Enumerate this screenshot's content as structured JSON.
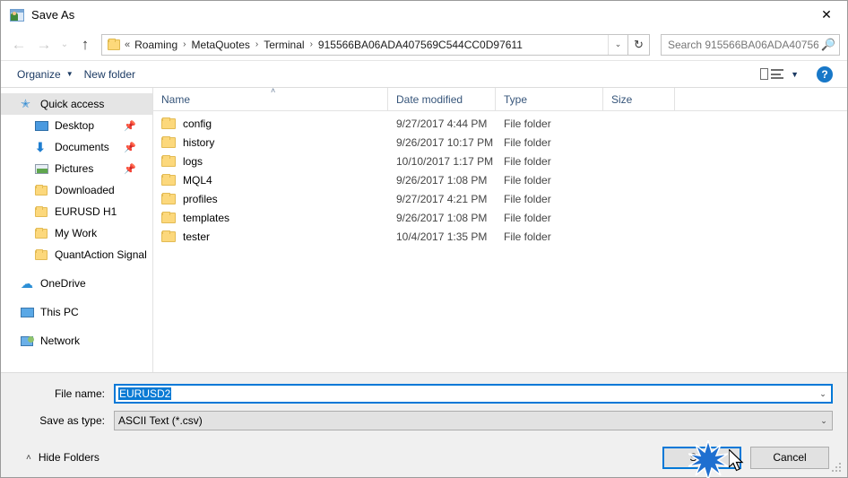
{
  "window": {
    "title": "Save As",
    "title_icon": "save-as-window-icon",
    "close_icon": "✕"
  },
  "nav": {
    "back_icon": "←",
    "forward_icon": "→",
    "recent_icon": "⌄",
    "up_icon": "↑",
    "refresh_icon": "↻",
    "dropdown_icon": "⌄",
    "folder_icon": "folder-icon",
    "overflow": "«",
    "breadcrumbs": [
      "Roaming",
      "MetaQuotes",
      "Terminal",
      "915566BA06ADA407569C544CC0D97611"
    ],
    "separator": "›"
  },
  "search": {
    "placeholder": "Search 915566BA06ADA40756...",
    "icon": "search-icon"
  },
  "toolbar": {
    "organize_label": "Organize",
    "organize_caret": "▼",
    "new_folder_label": "New folder",
    "view_caret": "▼",
    "help_label": "?"
  },
  "sidebar": {
    "items": [
      {
        "label": "Quick access",
        "icon": "star-icon",
        "selected": true,
        "level": "root",
        "pinned": false
      },
      {
        "label": "Desktop",
        "icon": "desktop-icon",
        "selected": false,
        "level": "child",
        "pinned": true
      },
      {
        "label": "Documents",
        "icon": "documents-icon",
        "selected": false,
        "level": "child",
        "pinned": true
      },
      {
        "label": "Pictures",
        "icon": "pictures-icon",
        "selected": false,
        "level": "child",
        "pinned": true
      },
      {
        "label": "Downloaded",
        "icon": "folder-icon",
        "selected": false,
        "level": "child",
        "pinned": false
      },
      {
        "label": "EURUSD H1",
        "icon": "folder-icon",
        "selected": false,
        "level": "child",
        "pinned": false
      },
      {
        "label": "My Work",
        "icon": "folder-icon",
        "selected": false,
        "level": "child",
        "pinned": false
      },
      {
        "label": "QuantAction Signal",
        "icon": "folder-icon",
        "selected": false,
        "level": "child",
        "pinned": false
      },
      {
        "label": "OneDrive",
        "icon": "cloud-icon",
        "selected": false,
        "level": "root",
        "pinned": false,
        "gap_before": true
      },
      {
        "label": "This PC",
        "icon": "computer-icon",
        "selected": false,
        "level": "root",
        "pinned": false,
        "gap_before": true
      },
      {
        "label": "Network",
        "icon": "network-icon",
        "selected": false,
        "level": "root",
        "pinned": false,
        "gap_before": true
      }
    ]
  },
  "filelist": {
    "columns": [
      "Name",
      "Date modified",
      "Type",
      "Size"
    ],
    "sort_indicator": "˄",
    "rows": [
      {
        "name": "config",
        "date": "9/27/2017 4:44 PM",
        "type": "File folder",
        "size": ""
      },
      {
        "name": "history",
        "date": "9/26/2017 10:17 PM",
        "type": "File folder",
        "size": ""
      },
      {
        "name": "logs",
        "date": "10/10/2017 1:17 PM",
        "type": "File folder",
        "size": ""
      },
      {
        "name": "MQL4",
        "date": "9/26/2017 1:08 PM",
        "type": "File folder",
        "size": ""
      },
      {
        "name": "profiles",
        "date": "9/27/2017 4:21 PM",
        "type": "File folder",
        "size": ""
      },
      {
        "name": "templates",
        "date": "9/26/2017 1:08 PM",
        "type": "File folder",
        "size": ""
      },
      {
        "name": "tester",
        "date": "10/4/2017 1:35 PM",
        "type": "File folder",
        "size": ""
      }
    ]
  },
  "form": {
    "filename_label": "File name:",
    "filename_value": "EURUSD2",
    "filetype_label": "Save as type:",
    "filetype_value": "ASCII Text (*.csv)",
    "dropdown_icon": "⌄"
  },
  "actions": {
    "hide_folders_label": "Hide Folders",
    "hide_folders_chev": "˄",
    "save_label": "Save",
    "cancel_label": "Cancel"
  },
  "colors": {
    "accent": "#0078d7",
    "selection": "#0a7ad4",
    "folder": "#fcd87c",
    "header_text": "#36557a",
    "help_blue": "#1878c8"
  }
}
